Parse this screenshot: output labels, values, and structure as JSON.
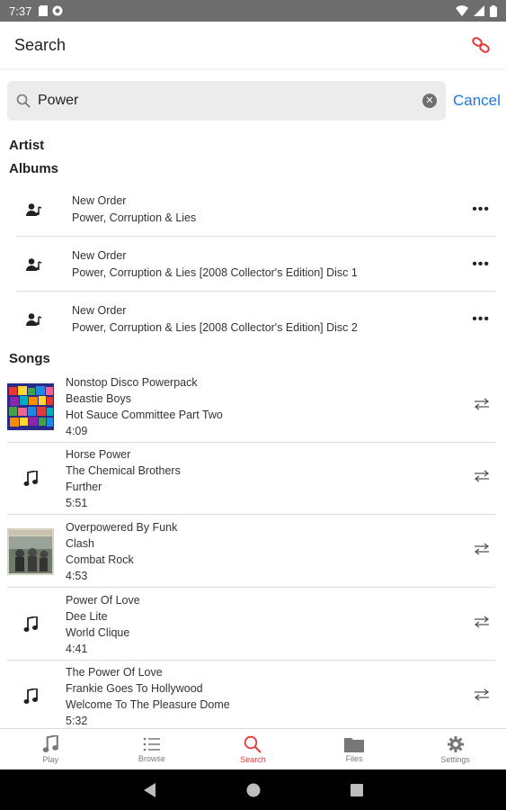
{
  "status_bar": {
    "time": "7:37"
  },
  "header": {
    "title": "Search"
  },
  "search": {
    "value": "Power",
    "cancel_label": "Cancel"
  },
  "sections": {
    "artist": "Artist",
    "albums": "Albums",
    "songs": "Songs"
  },
  "albums": [
    {
      "artist": "New Order",
      "title": "Power, Corruption & Lies"
    },
    {
      "artist": "New Order",
      "title": "Power, Corruption & Lies [2008 Collector's Edition] Disc 1"
    },
    {
      "artist": "New Order",
      "title": "Power, Corruption & Lies [2008 Collector's Edition] Disc 2"
    }
  ],
  "songs": [
    {
      "title": "Nonstop Disco Powerpack",
      "artist": "Beastie Boys",
      "album": "Hot Sauce Committee Part Two",
      "duration": "4:09",
      "artwork": "colorful-squares-cover"
    },
    {
      "title": "Horse Power",
      "artist": "The Chemical Brothers",
      "album": "Further",
      "duration": "5:51",
      "artwork": "music-note-icon"
    },
    {
      "title": "Overpowered By Funk",
      "artist": "Clash",
      "album": "Combat Rock",
      "duration": "4:53",
      "artwork": "photo-cover"
    },
    {
      "title": "Power Of Love",
      "artist": "Dee Lite",
      "album": "World Clique",
      "duration": "4:41",
      "artwork": "music-note-icon"
    },
    {
      "title": "The Power Of Love",
      "artist": "Frankie Goes To Hollywood",
      "album": "Welcome To The Pleasure Dome",
      "duration": "5:32",
      "artwork": "music-note-icon"
    }
  ],
  "tabs": [
    {
      "label": "Play",
      "icon": "music-note-icon"
    },
    {
      "label": "Browse",
      "icon": "list-icon"
    },
    {
      "label": "Search",
      "icon": "search-icon",
      "active": true
    },
    {
      "label": "Files",
      "icon": "folder-icon"
    },
    {
      "label": "Settings",
      "icon": "gear-icon"
    }
  ],
  "colors": {
    "accent": "#e53935",
    "link": "#1b7ae8",
    "status_bar": "#6d6d6d"
  }
}
